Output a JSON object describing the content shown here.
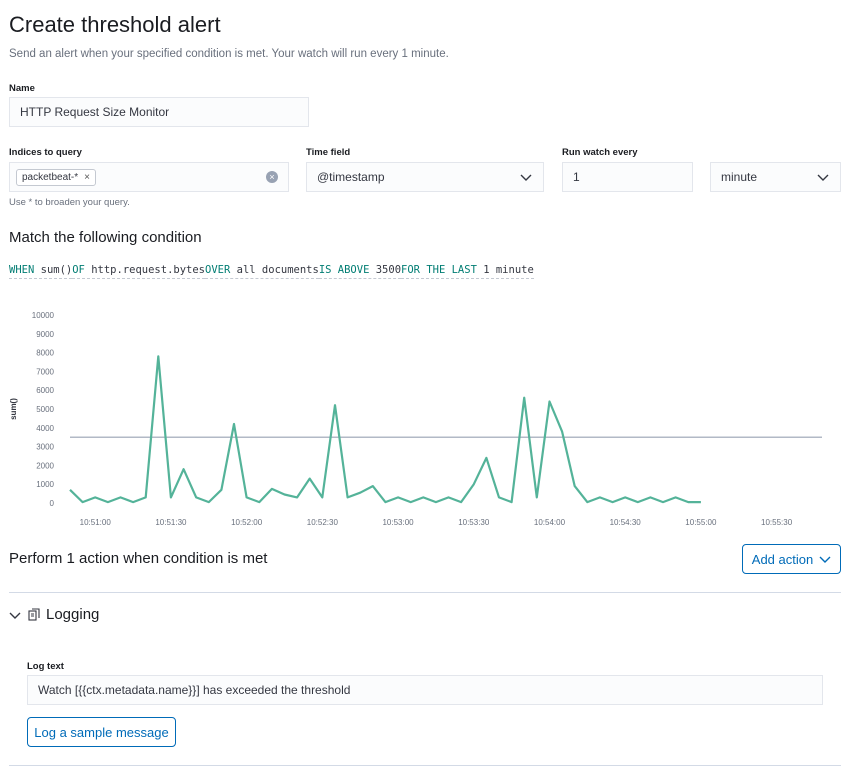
{
  "page": {
    "title": "Create threshold alert",
    "subtitle": "Send an alert when your specified condition is met. Your watch will run every 1 minute."
  },
  "form": {
    "name_label": "Name",
    "name_value": "HTTP Request Size Monitor",
    "indices_label": "Indices to query",
    "indices_pill": "packetbeat-*",
    "indices_help": "Use * to broaden your query.",
    "time_field_label": "Time field",
    "time_field_value": "@timestamp",
    "run_label": "Run watch every",
    "run_value": "1",
    "run_unit": "minute"
  },
  "condition": {
    "heading": "Match the following condition",
    "parts": [
      {
        "kw": "WHEN",
        "val": "sum()"
      },
      {
        "kw": "OF",
        "val": "http.request.bytes"
      },
      {
        "kw": "OVER",
        "val": "all documents"
      },
      {
        "kw": "IS ABOVE",
        "val": "3500"
      },
      {
        "kw": "FOR THE LAST",
        "val": "1 minute"
      }
    ]
  },
  "chart_data": {
    "type": "line",
    "title": "",
    "xlabel": "",
    "ylabel": "sum()",
    "ylim": [
      0,
      10000
    ],
    "yticks": [
      "10000",
      "9000",
      "8000",
      "7000",
      "6000",
      "5000",
      "4000",
      "3000",
      "2000",
      "1000",
      "0"
    ],
    "xticks": [
      "10:51:00",
      "10:51:30",
      "10:52:00",
      "10:52:30",
      "10:53:00",
      "10:53:30",
      "10:54:00",
      "10:54:30",
      "10:55:00",
      "10:55:30"
    ],
    "threshold": 3500,
    "colors": {
      "series": "#54b399",
      "threshold": "#98a2b3"
    },
    "series": [
      {
        "x": [
          "10:50:50",
          "10:50:55",
          "10:51:00",
          "10:51:05",
          "10:51:10",
          "10:51:15",
          "10:51:20",
          "10:51:25",
          "10:51:30",
          "10:51:35",
          "10:51:40",
          "10:51:45",
          "10:51:50",
          "10:51:55",
          "10:52:00",
          "10:52:05",
          "10:52:10",
          "10:52:15",
          "10:52:20",
          "10:52:25",
          "10:52:30",
          "10:52:35",
          "10:52:40",
          "10:52:45",
          "10:52:50",
          "10:52:55",
          "10:53:00",
          "10:53:05",
          "10:53:10",
          "10:53:15",
          "10:53:20",
          "10:53:25",
          "10:53:30",
          "10:53:35",
          "10:53:40",
          "10:53:45",
          "10:53:50",
          "10:53:55",
          "10:54:00",
          "10:54:05",
          "10:54:10",
          "10:54:15",
          "10:54:20",
          "10:54:25",
          "10:54:30",
          "10:54:35",
          "10:54:40",
          "10:54:45",
          "10:54:50",
          "10:54:55",
          "10:55:00"
        ],
        "values": [
          700,
          50,
          300,
          50,
          300,
          50,
          300,
          7800,
          300,
          1800,
          300,
          50,
          700,
          4200,
          300,
          50,
          750,
          450,
          300,
          1300,
          300,
          5200,
          300,
          550,
          900,
          50,
          300,
          50,
          300,
          50,
          300,
          50,
          1000,
          2400,
          300,
          50,
          5600,
          300,
          5400,
          3800,
          900,
          50,
          300,
          50,
          300,
          50,
          300,
          50,
          300,
          50,
          50
        ]
      }
    ]
  },
  "actions": {
    "heading": "Perform 1 action when condition is met",
    "add_action_label": "Add action",
    "logging": {
      "title": "Logging",
      "log_text_label": "Log text",
      "log_text_value": "Watch [{{ctx.metadata.name}}] has exceeded the threshold",
      "sample_button": "Log a sample message"
    }
  }
}
